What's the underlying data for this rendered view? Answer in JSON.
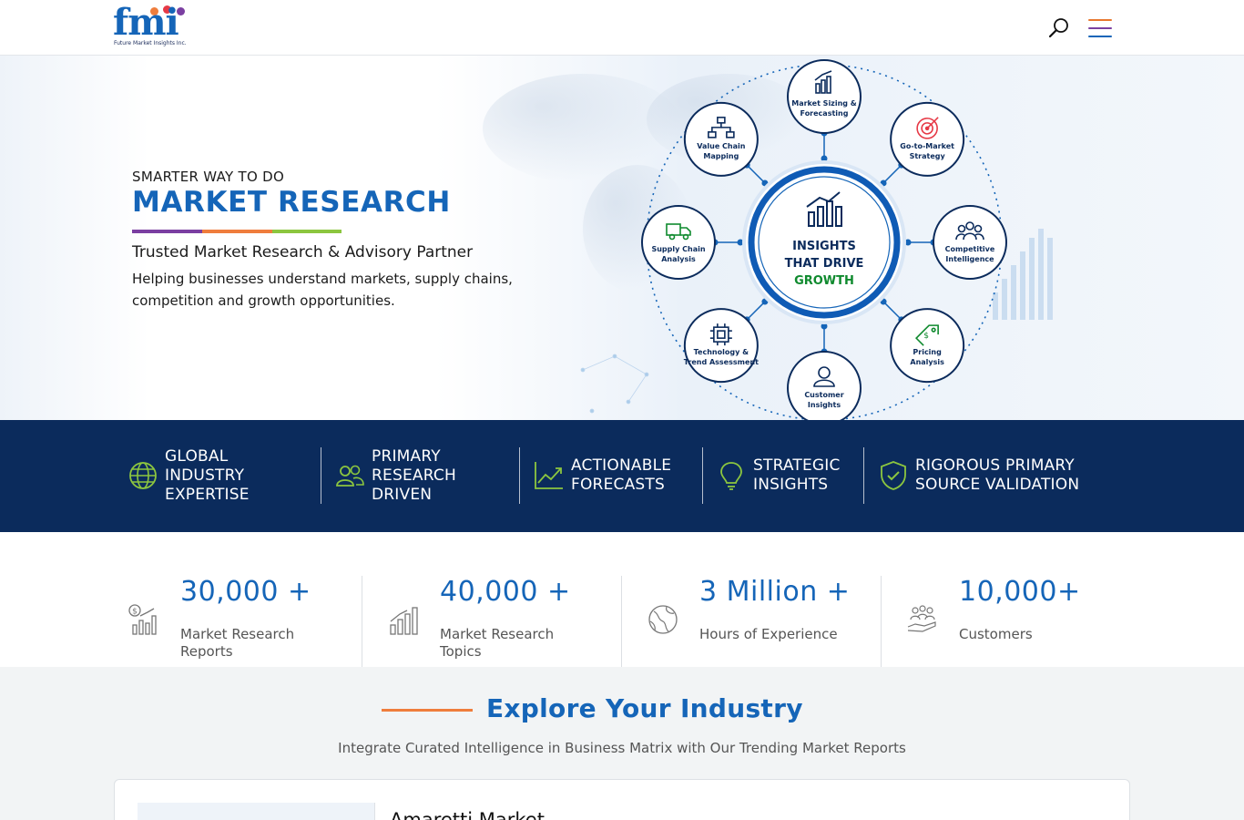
{
  "header": {
    "logo_text": "fmi",
    "logo_subtext": "Future Market Insights Inc.",
    "search_icon": "search-icon",
    "menu_icon": "hamburger-menu-icon",
    "menu_colors": [
      "#e8772e",
      "#7b3fa1",
      "#1565b8"
    ]
  },
  "hero": {
    "eyebrow": "SMARTER WAY TO DO",
    "title": "MARKET RESEARCH",
    "accent_colors": [
      "#7b3fa1",
      "#ef7d3c",
      "#8cc63f"
    ],
    "subtitle": "Trusted Market Research & Advisory Partner",
    "description": "Helping businesses understand markets, supply chains, competition and growth opportunities.",
    "graphic": {
      "center_lines": [
        "INSIGHTS",
        "THAT DRIVE",
        "GROWTH"
      ],
      "nodes": [
        {
          "lines": [
            "Market Sizing &",
            "Forecasting"
          ],
          "icon": "bar-chart-icon"
        },
        {
          "lines": [
            "Go-to-Market",
            "Strategy"
          ],
          "icon": "target-icon"
        },
        {
          "lines": [
            "Competitive",
            "Intelligence"
          ],
          "icon": "people-group-icon"
        },
        {
          "lines": [
            "Pricing",
            "Analysis"
          ],
          "icon": "price-tag-icon"
        },
        {
          "lines": [
            "Customer",
            "Insights"
          ],
          "icon": "user-icon"
        },
        {
          "lines": [
            "Technology &",
            "Trend Assessment"
          ],
          "icon": "chip-icon"
        },
        {
          "lines": [
            "Supply Chain",
            "Analysis"
          ],
          "icon": "truck-icon"
        },
        {
          "lines": [
            "Value Chain",
            "Mapping"
          ],
          "icon": "hierarchy-icon"
        }
      ]
    }
  },
  "features": [
    {
      "label": "GLOBAL INDUSTRY EXPERTISE",
      "icon": "globe-icon"
    },
    {
      "label": "PRIMARY RESEARCH DRIVEN",
      "icon": "people-icon"
    },
    {
      "label": "ACTIONABLE FORECASTS",
      "icon": "trend-chart-icon"
    },
    {
      "label": "STRATEGIC INSIGHTS",
      "icon": "lightbulb-icon"
    },
    {
      "label": "RIGOROUS PRIMARY SOURCE VALIDATION",
      "icon": "shield-check-icon"
    }
  ],
  "feature_icon_color": "#8cc63f",
  "stats": [
    {
      "number": "30,000 +",
      "label": "Market Research Reports",
      "icon": "report-chart-icon"
    },
    {
      "number": "40,000 +",
      "label": "Market Research Topics",
      "icon": "bar-growth-icon"
    },
    {
      "number": "3 Million +",
      "label": "Hours of Experience",
      "icon": "globe-outline-icon"
    },
    {
      "number": "10,000+",
      "label": "Customers",
      "icon": "customers-hand-icon"
    }
  ],
  "explore": {
    "title": "Explore Your Industry",
    "subtitle": "Integrate Curated Intelligence in Business Matrix with Our Trending Market Reports",
    "first_card_title": "Amaretti Market"
  }
}
